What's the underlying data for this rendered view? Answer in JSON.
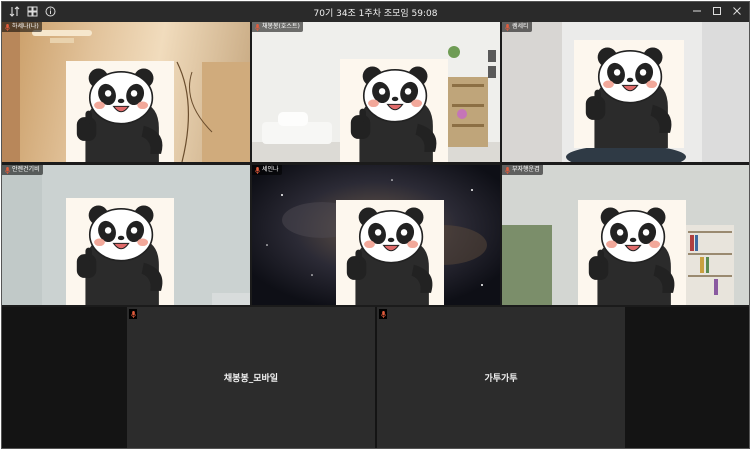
{
  "window": {
    "title": "70기 34조 1주차 조모임 59:08"
  },
  "participants": [
    {
      "name": "하세나(나)",
      "background": "warm-room"
    },
    {
      "name": "채봉봉(호스트)",
      "background": "white-room"
    },
    {
      "name": "쌤세티",
      "background": "bright-room"
    },
    {
      "name": "안젠건기비",
      "background": "grey-wall"
    },
    {
      "name": "세인나",
      "background": "galaxy"
    },
    {
      "name": "부자행운겸",
      "background": "office"
    }
  ],
  "no_video_participants": [
    {
      "name": "채봉봉_모바일"
    },
    {
      "name": "가투가투"
    }
  ],
  "icons": {
    "toolbar": [
      "sort-icon",
      "grid-icon",
      "info-icon"
    ],
    "window_controls": [
      "minimize-icon",
      "maximize-icon",
      "close-icon"
    ],
    "tile_badge": "mic-muted-icon",
    "avatar": "panda-thumbs-up-sticker"
  }
}
